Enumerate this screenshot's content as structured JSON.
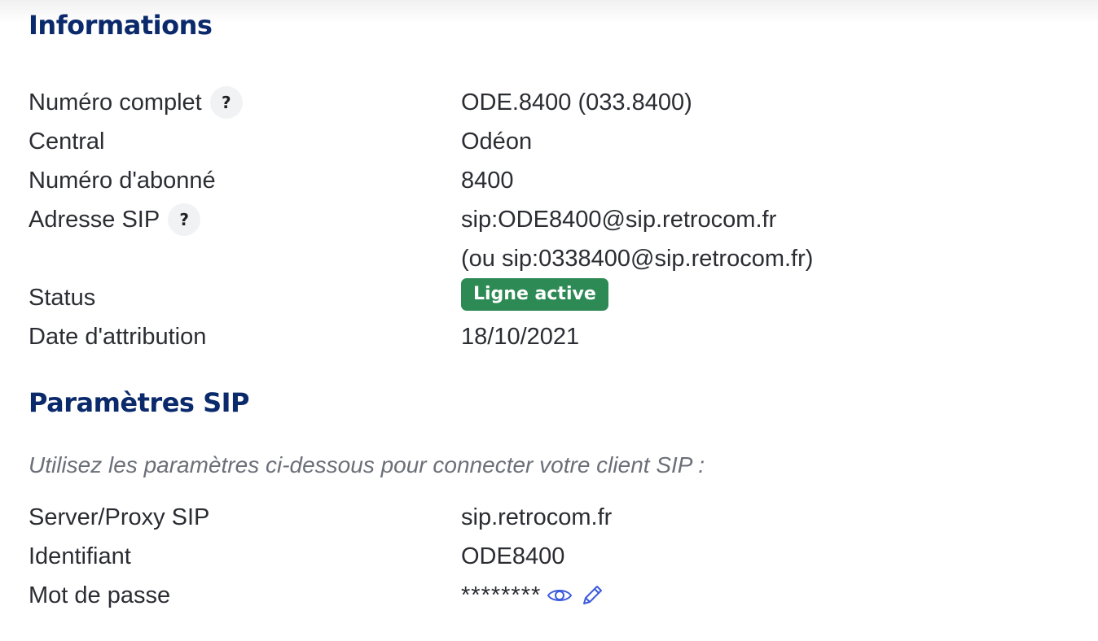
{
  "informations": {
    "title": "Informations",
    "rows": {
      "numero_complet": {
        "label": "Numéro complet",
        "help": "?",
        "value": "ODE.8400 (033.8400)"
      },
      "central": {
        "label": "Central",
        "value": "Odéon"
      },
      "numero_abonne": {
        "label": "Numéro d'abonné",
        "value": "8400"
      },
      "adresse_sip": {
        "label": "Adresse SIP",
        "help": "?",
        "value": "sip:ODE8400@sip.retrocom.fr",
        "value_alt": "(ou sip:0338400@sip.retrocom.fr)"
      },
      "status": {
        "label": "Status",
        "badge": "Ligne active",
        "badge_color": "#2d8a55"
      },
      "date_attribution": {
        "label": "Date d'attribution",
        "value": "18/10/2021"
      }
    }
  },
  "sip": {
    "title": "Paramètres SIP",
    "hint": "Utilisez les paramètres ci-dessous pour connecter votre client SIP :",
    "rows": {
      "server": {
        "label": "Server/Proxy SIP",
        "value": "sip.retrocom.fr"
      },
      "identifiant": {
        "label": "Identifiant",
        "value": "ODE8400"
      },
      "password": {
        "label": "Mot de passe",
        "value": "********",
        "show_icon": "eye-icon",
        "edit_icon": "pencil-icon"
      }
    }
  },
  "colors": {
    "heading": "#0b2a6b",
    "text": "#2b2d33",
    "hint": "#6b6f78",
    "icon_accent": "#3b5bdb"
  }
}
